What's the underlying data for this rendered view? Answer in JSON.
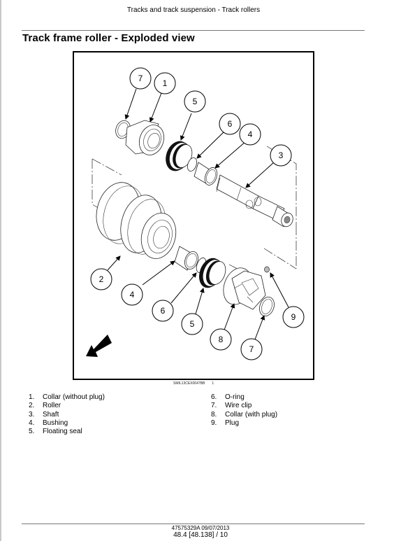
{
  "header": {
    "running_title": "Tracks and track suspension - Track rollers"
  },
  "page_title": "Track frame roller - Exploded view",
  "figure": {
    "caption_code": "SMIL13CEX0647BB",
    "caption_number": "1",
    "direction_arrow": "arrow-icon",
    "callouts": [
      {
        "id": "c7a",
        "label": "7"
      },
      {
        "id": "c1",
        "label": "1"
      },
      {
        "id": "c5a",
        "label": "5"
      },
      {
        "id": "c6a",
        "label": "6"
      },
      {
        "id": "c4a",
        "label": "4"
      },
      {
        "id": "c3",
        "label": "3"
      },
      {
        "id": "c2",
        "label": "2"
      },
      {
        "id": "c4b",
        "label": "4"
      },
      {
        "id": "c6b",
        "label": "6"
      },
      {
        "id": "c5b",
        "label": "5"
      },
      {
        "id": "c8",
        "label": "8"
      },
      {
        "id": "c7b",
        "label": "7"
      },
      {
        "id": "c9",
        "label": "9"
      }
    ]
  },
  "legend": {
    "column1": [
      {
        "num": "1.",
        "text": "Collar (without plug)"
      },
      {
        "num": "2.",
        "text": "Roller"
      },
      {
        "num": "3.",
        "text": "Shaft"
      },
      {
        "num": "4.",
        "text": "Bushing"
      },
      {
        "num": "5.",
        "text": "Floating seal"
      }
    ],
    "column2": [
      {
        "num": "6.",
        "text": "O-ring"
      },
      {
        "num": "7.",
        "text": "Wire clip"
      },
      {
        "num": "8.",
        "text": "Collar (with plug)"
      },
      {
        "num": "9.",
        "text": "Plug"
      }
    ]
  },
  "footer": {
    "doc_ref": "47575329A 09/07/2013",
    "page_ref": "48.4 [48.138] / 10"
  }
}
